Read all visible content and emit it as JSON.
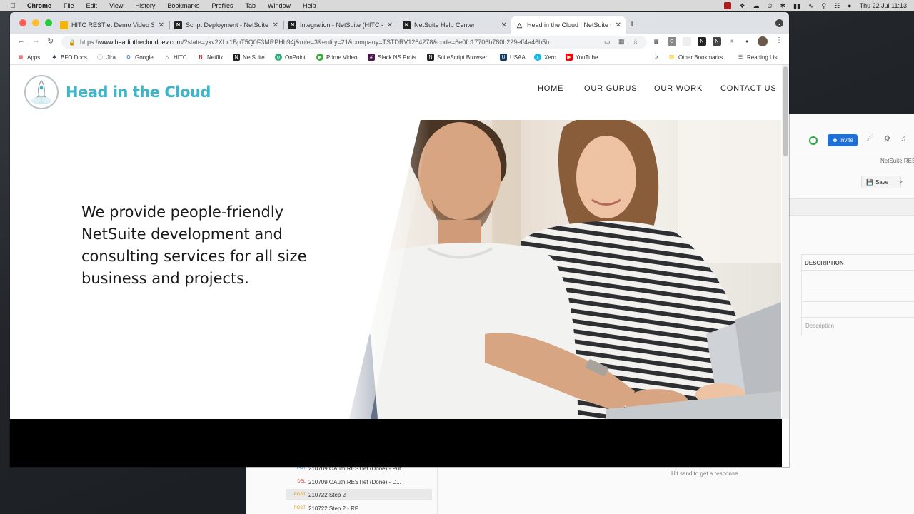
{
  "menubar": {
    "apple": "",
    "items": [
      "Chrome",
      "File",
      "Edit",
      "View",
      "History",
      "Bookmarks",
      "Profiles",
      "Tab",
      "Window",
      "Help"
    ],
    "clock": "Thu 22 Jul  11:13"
  },
  "browser": {
    "tabs": [
      {
        "title": "HITC RESTlet Demo Video Slid",
        "favicon": "slides"
      },
      {
        "title": "Script Deployment - NetSuite (",
        "favicon": "ns"
      },
      {
        "title": "Integration - NetSuite (HITC - ",
        "favicon": "ns"
      },
      {
        "title": "NetSuite Help Center",
        "favicon": "ns"
      },
      {
        "title": "Head in the Cloud | NetSuite C",
        "favicon": "hitc",
        "active": true
      }
    ],
    "url_prefix": "https://",
    "url_domain": "www.headintheclouddev.com",
    "url_rest": "/?state=ykv2XLx1BpT5Q0F3MRPHb94j&role=3&entity=21&company=TSTDRV1264278&code=6e0fc17706b780b229eff4a46b5b",
    "bookmarks": [
      {
        "label": "Apps"
      },
      {
        "label": "BFO Docs"
      },
      {
        "label": "Jira"
      },
      {
        "label": "Google"
      },
      {
        "label": "HITC"
      },
      {
        "label": "Netflix"
      },
      {
        "label": "NetSuite"
      },
      {
        "label": "OnPoint"
      },
      {
        "label": "Prime Video"
      },
      {
        "label": "Slack NS Profs"
      },
      {
        "label": "SuiteScript Browser"
      },
      {
        "label": "USAA"
      },
      {
        "label": "Xero"
      },
      {
        "label": "YouTube"
      }
    ],
    "bookmarks_overflow": "»",
    "other_bookmarks": "Other Bookmarks",
    "reading_list": "Reading List"
  },
  "site": {
    "logo_text": "Head in the Cloud",
    "nav": [
      "HOME",
      "OUR GURUS",
      "OUR WORK",
      "CONTACT US"
    ],
    "hero_text": "We provide people-friendly NetSuite development and consulting services for all sizes of business and projects."
  },
  "postman": {
    "invite": "Invite",
    "tab_title": "NetSuite RES",
    "save": "Save",
    "description_header": "DESCRIPTION",
    "description_placeholder": "Description",
    "requests": [
      {
        "method": "PUT",
        "name": "210709 OAuth RESTlet (Done) - Put"
      },
      {
        "method": "DEL",
        "name": "210709 OAuth RESTlet (Done) - D..."
      },
      {
        "method": "POST",
        "name": "210722 Step 2",
        "selected": true
      },
      {
        "method": "POST",
        "name": "210722 Step 2 - RP"
      }
    ],
    "hint": "Hit send to get a response"
  },
  "colors": {
    "brand": "#3fb5c9",
    "invite": "#1f6fd8"
  }
}
